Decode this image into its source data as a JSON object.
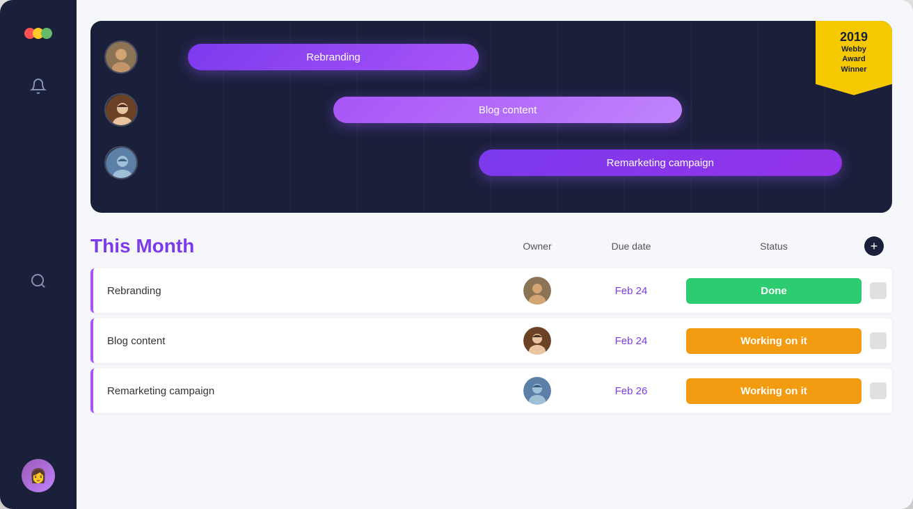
{
  "sidebar": {
    "logo_label": "Monday",
    "notification_icon": "bell",
    "search_icon": "search",
    "avatar_emoji": "👩"
  },
  "gantt": {
    "bars": [
      {
        "label": "Rebranding",
        "offset_pct": 5,
        "width_pct": 40,
        "class": "gantt-bar-1"
      },
      {
        "label": "Blog content",
        "offset_pct": 25,
        "width_pct": 48,
        "class": "gantt-bar-2"
      },
      {
        "label": "Remarketing campaign",
        "offset_pct": 45,
        "width_pct": 50,
        "class": "gantt-bar-3"
      }
    ],
    "avatars": [
      "man1",
      "woman1",
      "man2"
    ]
  },
  "award": {
    "year": "2019",
    "line1": "Webby",
    "line2": "Award",
    "line3": "Winner"
  },
  "table": {
    "section_title": "This Month",
    "col_owner": "Owner",
    "col_date": "Due date",
    "col_status": "Status",
    "add_icon": "+",
    "rows": [
      {
        "name": "Rebranding",
        "owner_avatar": "man1",
        "due_date": "Feb 24",
        "status_label": "Done",
        "status_class": "status-done"
      },
      {
        "name": "Blog content",
        "owner_avatar": "woman1",
        "due_date": "Feb 24",
        "status_label": "Working on it",
        "status_class": "status-working"
      },
      {
        "name": "Remarketing campaign",
        "owner_avatar": "man2",
        "due_date": "Feb 26",
        "status_label": "Working on it",
        "status_class": "status-working"
      }
    ]
  }
}
